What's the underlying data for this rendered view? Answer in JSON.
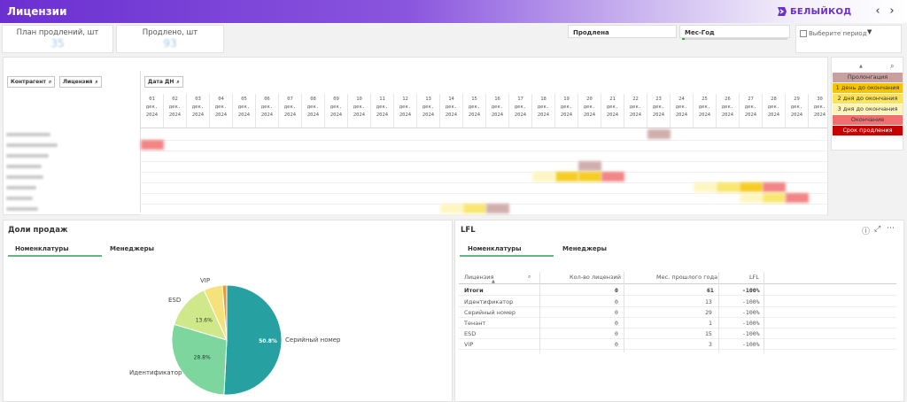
{
  "app": {
    "title": "Лицензии",
    "brand": "БЕЛЫЙКОД",
    "brand_color": "#6b2fd1"
  },
  "kpis": [
    {
      "label": "План продлений, шт",
      "value": "35"
    },
    {
      "label": "Продлено, шт",
      "value": "93"
    }
  ],
  "filters": {
    "renewed": "Продлена",
    "month_year": "Мес-Год",
    "period_placeholder": "Выберите период"
  },
  "grid": {
    "headers": {
      "counterparty": "Контрагент",
      "license": "Лицензия",
      "date": "Дата ДН"
    },
    "days": [
      "01",
      "02",
      "03",
      "04",
      "05",
      "06",
      "07",
      "08",
      "09",
      "10",
      "11",
      "12",
      "13",
      "14",
      "15",
      "16",
      "17",
      "18",
      "19",
      "20",
      "21",
      "22",
      "23",
      "24",
      "25",
      "26",
      "27",
      "28",
      "29",
      "30"
    ],
    "month": "дек.",
    "year": "2024"
  },
  "legend": [
    {
      "label": "Пролонгация",
      "color": "#c9a0a0"
    },
    {
      "label": "1 день до окончания",
      "color": "#f5c400"
    },
    {
      "label": "2 дня до окончания",
      "color": "#f8e35a"
    },
    {
      "label": "3 дня до окончания",
      "color": "#fdf5b8"
    },
    {
      "label": "Окончание",
      "color": "#f07070"
    },
    {
      "label": "Срок продления",
      "color": "#c80000"
    }
  ],
  "sales": {
    "title": "Доли продаж",
    "tabs": [
      "Номенклатуры",
      "Менеджеры"
    ]
  },
  "chart_data": {
    "type": "pie",
    "slices": [
      {
        "label": "Серийный номер",
        "value": 50.8,
        "value_label": "50.8%",
        "color": "#26a0a0"
      },
      {
        "label": "Идентификатор",
        "value": 28.8,
        "value_label": "28.8%",
        "color": "#7dd69d"
      },
      {
        "label": "ESD",
        "value": 13.6,
        "value_label": "13.6%",
        "color": "#cfe98a"
      },
      {
        "label": "VIP",
        "value": 5.5,
        "value_label": "",
        "color": "#f6e27a"
      },
      {
        "label": "",
        "value": 1.3,
        "value_label": "",
        "color": "#e39a40"
      }
    ]
  },
  "lfl": {
    "title": "LFL",
    "tabs": [
      "Номенклатуры",
      "Менеджеры"
    ],
    "columns": [
      "Лицензия",
      "Кол-во лицензий",
      "Мес. прошлого года",
      "LFL"
    ],
    "total": {
      "name": "Итоги",
      "qty": "0",
      "prev": "61",
      "lfl": "-100%"
    },
    "rows": [
      {
        "name": "Идентификатор",
        "qty": "0",
        "prev": "13",
        "lfl": "-100%"
      },
      {
        "name": "Серийный номер",
        "qty": "0",
        "prev": "29",
        "lfl": "-100%"
      },
      {
        "name": "Тенант",
        "qty": "0",
        "prev": "1",
        "lfl": "-100%"
      },
      {
        "name": "ESD",
        "qty": "0",
        "prev": "15",
        "lfl": "-100%"
      },
      {
        "name": "VIP",
        "qty": "0",
        "prev": "3",
        "lfl": "-100%"
      }
    ]
  }
}
